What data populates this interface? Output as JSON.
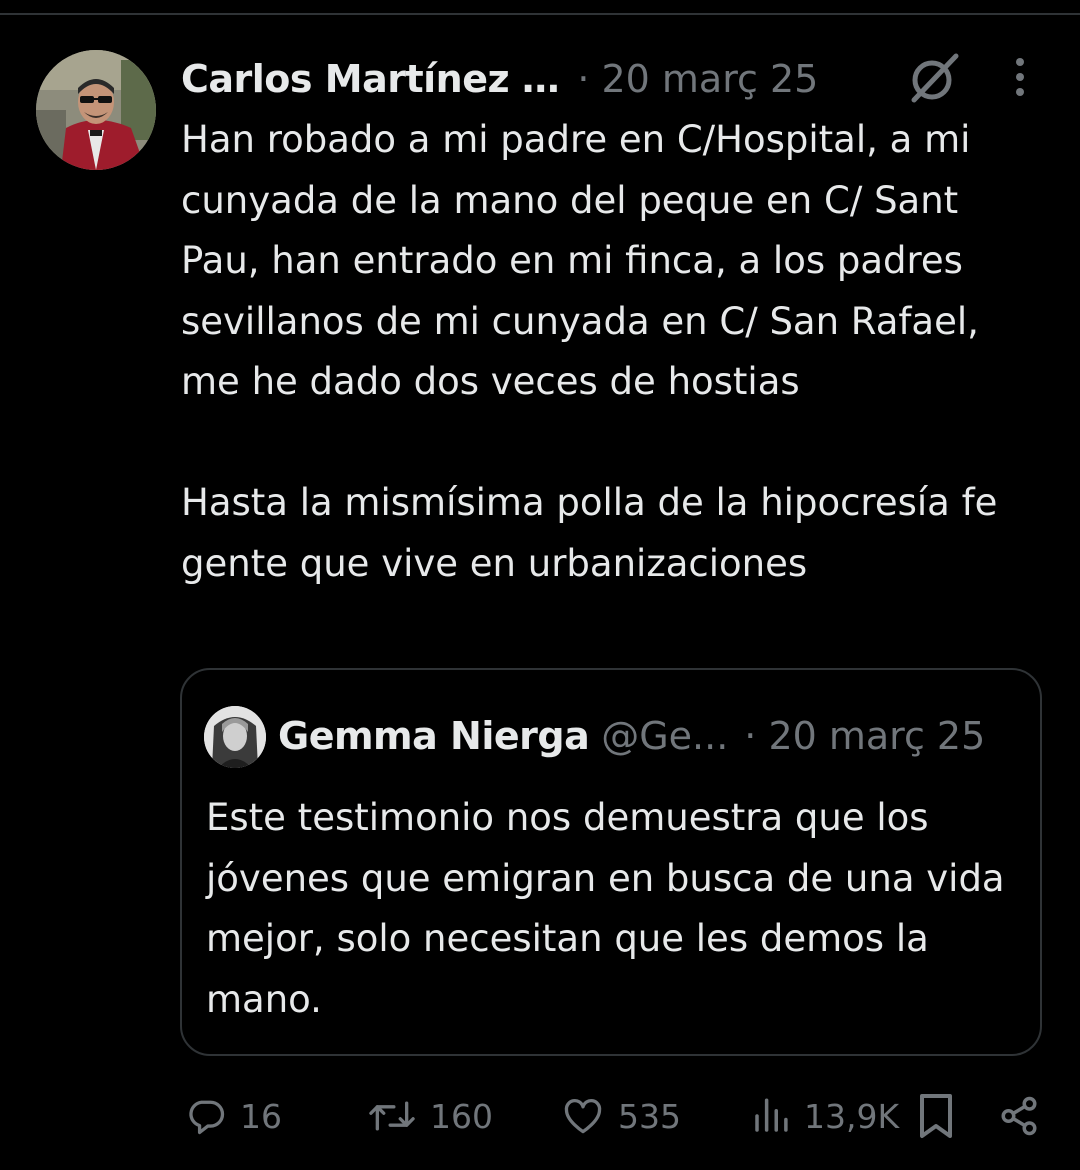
{
  "tweet": {
    "author_name": "Carlos Martínez …",
    "meta": "· 20 març 25",
    "text": "Han robado a mi padre en C/Hospital, a mi cunyada de la mano del peque en C/ Sant Pau, han entrado en mi finca, a los padres sevillanos de mi cunyada en C/ San Rafael, me he dado dos veces de hostias\n\nHasta la mismísima polla de la hipocresía fe gente que vive en urbanizaciones",
    "avatar_icon": "avatar-photo",
    "grok_icon": "grok-icon",
    "more_icon": "more-dots-icon"
  },
  "quote": {
    "author_name": "Gemma Nierga",
    "handle": "@Ge...",
    "date": "· 20 març 25",
    "text": "Este testimonio nos demuestra que los jóvenes que emigran en busca de una vida mejor, solo necesitan que les demos la mano.",
    "avatar_icon": "avatar-photo"
  },
  "actions": {
    "replies": "16",
    "reposts": "160",
    "likes": "535",
    "views": "13,9K",
    "bookmark_icon": "bookmark-icon",
    "share_icon": "share-icon"
  },
  "colors": {
    "background": "#000000",
    "text_primary": "#e7e9ea",
    "text_secondary": "#71767b",
    "border": "#2f3336"
  }
}
